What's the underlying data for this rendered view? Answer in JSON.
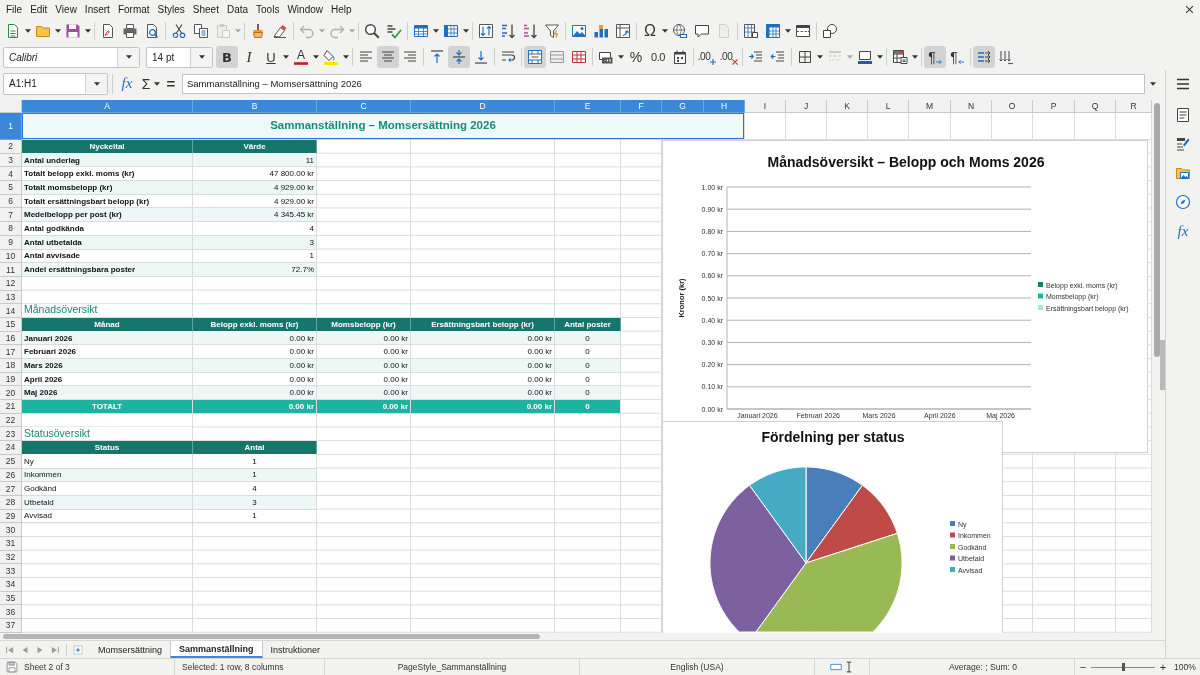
{
  "menu_bar": [
    "File",
    "Edit",
    "View",
    "Insert",
    "Format",
    "Styles",
    "Sheet",
    "Data",
    "Tools",
    "Window",
    "Help"
  ],
  "standard_toolbar": [
    [
      {
        "kind": "new",
        "dropdown": true,
        "disabled": false
      },
      {
        "kind": "open",
        "dropdown": true,
        "disabled": false
      },
      {
        "kind": "save",
        "dropdown": true,
        "disabled": false
      }
    ],
    [
      {
        "kind": "export-pdf",
        "dropdown": false,
        "disabled": false
      },
      {
        "kind": "print",
        "dropdown": false,
        "disabled": false
      },
      {
        "kind": "print-preview",
        "dropdown": false,
        "disabled": false
      }
    ],
    [
      {
        "kind": "cut",
        "dropdown": false,
        "disabled": false
      },
      {
        "kind": "copy",
        "dropdown": false,
        "disabled": false
      },
      {
        "kind": "paste",
        "dropdown": true,
        "disabled": true
      }
    ],
    [
      {
        "kind": "clone-formatting",
        "dropdown": false,
        "disabled": false
      },
      {
        "kind": "clear-formatting",
        "dropdown": false,
        "disabled": false
      }
    ],
    [
      {
        "kind": "undo",
        "dropdown": true,
        "disabled": true
      },
      {
        "kind": "redo",
        "dropdown": true,
        "disabled": true
      }
    ],
    [
      {
        "kind": "find-replace",
        "dropdown": false,
        "disabled": false
      },
      {
        "kind": "spelling",
        "dropdown": false,
        "disabled": false
      }
    ],
    [
      {
        "kind": "rows",
        "dropdown": true,
        "disabled": false
      },
      {
        "kind": "columns",
        "dropdown": true,
        "disabled": false
      }
    ],
    [
      {
        "kind": "sort",
        "dropdown": false,
        "disabled": false
      },
      {
        "kind": "sort-ascending",
        "dropdown": false,
        "disabled": false
      },
      {
        "kind": "sort-descending",
        "dropdown": false,
        "disabled": false
      },
      {
        "kind": "autofilter",
        "dropdown": false,
        "disabled": false
      }
    ],
    [
      {
        "kind": "image",
        "dropdown": false,
        "disabled": false
      },
      {
        "kind": "chart",
        "dropdown": false,
        "disabled": false
      },
      {
        "kind": "pivot-table",
        "dropdown": false,
        "disabled": false
      }
    ],
    [
      {
        "kind": "special-character",
        "glyph": "Ω",
        "dropdown": true,
        "disabled": false
      },
      {
        "kind": "hyperlink",
        "dropdown": false,
        "disabled": false
      },
      {
        "kind": "comment",
        "dropdown": false,
        "disabled": false
      },
      {
        "kind": "header-footer",
        "dropdown": false,
        "disabled": true
      }
    ],
    [
      {
        "kind": "print-area",
        "dropdown": false,
        "disabled": false
      },
      {
        "kind": "freeze",
        "dropdown": true,
        "disabled": false
      },
      {
        "kind": "split-window",
        "dropdown": false,
        "disabled": false
      }
    ],
    [
      {
        "kind": "draw-functions",
        "dropdown": false,
        "disabled": false
      }
    ]
  ],
  "formatting_toolbar": {
    "font_name": "Calibri",
    "font_size": "14 pt",
    "groups": [
      [
        {
          "kind": "bold",
          "glyph": "B",
          "pressed": true,
          "dropdown": false,
          "disabled": false
        },
        {
          "kind": "italic",
          "glyph": "I",
          "pressed": false,
          "dropdown": false,
          "disabled": false
        },
        {
          "kind": "underline",
          "glyph": "U",
          "pressed": false,
          "dropdown": true,
          "disabled": false
        },
        {
          "kind": "font-color",
          "glyph": "A",
          "pressed": false,
          "dropdown": true,
          "disabled": false
        },
        {
          "kind": "highlight",
          "pressed": false,
          "dropdown": true,
          "disabled": false
        }
      ],
      [
        {
          "kind": "align-left",
          "pressed": false,
          "dropdown": false,
          "disabled": false
        },
        {
          "kind": "align-center",
          "pressed": true,
          "dropdown": false,
          "disabled": false
        },
        {
          "kind": "align-right",
          "pressed": false,
          "dropdown": false,
          "disabled": false
        }
      ],
      [
        {
          "kind": "align-top",
          "pressed": false,
          "dropdown": false,
          "disabled": false
        },
        {
          "kind": "align-middle",
          "pressed": true,
          "dropdown": false,
          "disabled": false
        },
        {
          "kind": "align-bottom",
          "pressed": false,
          "dropdown": false,
          "disabled": false
        }
      ],
      [
        {
          "kind": "wrap-text",
          "pressed": false,
          "dropdown": false,
          "disabled": false
        }
      ],
      [
        {
          "kind": "merge-center",
          "pressed": true,
          "dropdown": false,
          "disabled": false
        },
        {
          "kind": "merge",
          "pressed": false,
          "dropdown": false,
          "disabled": false
        },
        {
          "kind": "unmerge",
          "pressed": false,
          "dropdown": false,
          "disabled": false
        }
      ],
      [
        {
          "kind": "currency",
          "pressed": false,
          "dropdown": true,
          "disabled": false
        },
        {
          "kind": "percent",
          "glyph": "%",
          "pressed": false,
          "dropdown": false,
          "disabled": false
        },
        {
          "kind": "number",
          "glyph": "0.0",
          "pressed": false,
          "dropdown": false,
          "disabled": false
        },
        {
          "kind": "date",
          "pressed": false,
          "dropdown": false,
          "disabled": false
        }
      ],
      [
        {
          "kind": "add-decimal",
          "glyph": ".00",
          "pressed": false,
          "dropdown": false,
          "disabled": false
        },
        {
          "kind": "delete-decimal",
          "glyph": ".00",
          "pressed": false,
          "dropdown": false,
          "disabled": false
        }
      ],
      [
        {
          "kind": "increase-indent",
          "pressed": false,
          "dropdown": false,
          "disabled": false
        },
        {
          "kind": "decrease-indent",
          "pressed": false,
          "dropdown": false,
          "disabled": false
        }
      ],
      [
        {
          "kind": "borders",
          "pressed": false,
          "dropdown": true,
          "disabled": false
        },
        {
          "kind": "border-style",
          "pressed": false,
          "dropdown": true,
          "disabled": true
        },
        {
          "kind": "border-color",
          "pressed": false,
          "dropdown": true,
          "disabled": false
        }
      ],
      [
        {
          "kind": "conditional",
          "pressed": false,
          "dropdown": true,
          "disabled": false
        }
      ],
      [
        {
          "kind": "left-to-right",
          "glyph": "¶",
          "pressed": true,
          "dropdown": false,
          "disabled": false
        },
        {
          "kind": "right-to-left",
          "glyph": "¶",
          "pressed": false,
          "dropdown": false,
          "disabled": false
        }
      ],
      [
        {
          "kind": "text-left-to-right",
          "pressed": true,
          "dropdown": false,
          "disabled": false
        },
        {
          "kind": "text-top-to-bottom",
          "pressed": false,
          "dropdown": false,
          "disabled": false
        }
      ]
    ]
  },
  "formula_bar": {
    "name_box": "A1:H1",
    "function_wizard": "fx",
    "sum": "Σ",
    "equals": "=",
    "content": "Sammanställning – Momsersättning 2026"
  },
  "sidebar": {
    "buttons": [
      {
        "kind": "menu"
      },
      {
        "kind": "properties"
      },
      {
        "kind": "styles"
      },
      {
        "kind": "gallery"
      },
      {
        "kind": "navigator"
      },
      {
        "kind": "functions",
        "glyph": "fx"
      }
    ]
  },
  "sheet": {
    "columns": [
      {
        "label": "A",
        "selected": true
      },
      {
        "label": "B",
        "selected": true
      },
      {
        "label": "C",
        "selected": true
      },
      {
        "label": "D",
        "selected": true
      },
      {
        "label": "E",
        "selected": true
      },
      {
        "label": "F",
        "selected": true
      },
      {
        "label": "G",
        "selected": true
      },
      {
        "label": "H",
        "selected": true
      },
      {
        "label": "I",
        "selected": false
      },
      {
        "label": "J",
        "selected": false
      },
      {
        "label": "K",
        "selected": false
      },
      {
        "label": "L",
        "selected": false
      },
      {
        "label": "M",
        "selected": false
      },
      {
        "label": "N",
        "selected": false
      },
      {
        "label": "O",
        "selected": false
      },
      {
        "label": "P",
        "selected": false
      },
      {
        "label": "Q",
        "selected": false
      },
      {
        "label": "R",
        "selected": false
      }
    ],
    "rows": [
      {
        "label": "1",
        "selected": true
      },
      {
        "label": "2",
        "selected": false
      },
      {
        "label": "3",
        "selected": false
      },
      {
        "label": "4",
        "selected": false
      },
      {
        "label": "5",
        "selected": false
      },
      {
        "label": "6",
        "selected": false
      },
      {
        "label": "7",
        "selected": false
      },
      {
        "label": "8",
        "selected": false
      },
      {
        "label": "9",
        "selected": false
      },
      {
        "label": "10",
        "selected": false
      },
      {
        "label": "11",
        "selected": false
      },
      {
        "label": "12",
        "selected": false
      },
      {
        "label": "13",
        "selected": false
      },
      {
        "label": "14",
        "selected": false
      },
      {
        "label": "15",
        "selected": false
      },
      {
        "label": "16",
        "selected": false
      },
      {
        "label": "17",
        "selected": false
      },
      {
        "label": "18",
        "selected": false
      },
      {
        "label": "19",
        "selected": false
      },
      {
        "label": "20",
        "selected": false
      },
      {
        "label": "21",
        "selected": false
      },
      {
        "label": "22",
        "selected": false
      },
      {
        "label": "23",
        "selected": false
      },
      {
        "label": "24",
        "selected": false
      },
      {
        "label": "25",
        "selected": false
      },
      {
        "label": "26",
        "selected": false
      },
      {
        "label": "27",
        "selected": false
      },
      {
        "label": "28",
        "selected": false
      },
      {
        "label": "29",
        "selected": false
      },
      {
        "label": "30",
        "selected": false
      },
      {
        "label": "31",
        "selected": false
      },
      {
        "label": "32",
        "selected": false
      },
      {
        "label": "33",
        "selected": false
      },
      {
        "label": "34",
        "selected": false
      },
      {
        "label": "35",
        "selected": false
      },
      {
        "label": "36",
        "selected": false
      },
      {
        "label": "37",
        "selected": false
      }
    ],
    "title": {
      "text": "Sammanställning – Momsersättning 2026",
      "selected": true
    },
    "key_figures": {
      "columns": [
        "Nyckeltal",
        "Värde"
      ],
      "rows": [
        [
          "Antal underlag",
          "11"
        ],
        [
          "Totalt belopp exkl. moms (kr)",
          "47 800.00 kr"
        ],
        [
          "Totalt momsbelopp (kr)",
          "4 929.00 kr"
        ],
        [
          "Totalt ersättningsbart belopp (kr)",
          "4 929.00 kr"
        ],
        [
          "Medelbelopp per post (kr)",
          "4 345.45 kr"
        ],
        [
          "Antal godkända",
          "4"
        ],
        [
          "Antal utbetalda",
          "3"
        ],
        [
          "Antal avvisade",
          "1"
        ],
        [
          "Andel ersättningsbara poster",
          "72.7%"
        ]
      ]
    },
    "monthly_overview": {
      "heading": "Månadsöversikt",
      "columns": [
        "Månad",
        "Belopp exkl. moms (kr)",
        "Momsbelopp (kr)",
        "Ersättningsbart belopp (kr)",
        "Antal poster"
      ],
      "rows": [
        {
          "kind": "month",
          "cells": [
            "Januari 2026",
            "0.00 kr",
            "0.00 kr",
            "0.00 kr",
            "0"
          ]
        },
        {
          "kind": "month",
          "cells": [
            "Februari 2026",
            "0.00 kr",
            "0.00 kr",
            "0.00 kr",
            "0"
          ]
        },
        {
          "kind": "month",
          "cells": [
            "Mars 2026",
            "0.00 kr",
            "0.00 kr",
            "0.00 kr",
            "0"
          ]
        },
        {
          "kind": "month",
          "cells": [
            "April 2026",
            "0.00 kr",
            "0.00 kr",
            "0.00 kr",
            "0"
          ]
        },
        {
          "kind": "month",
          "cells": [
            "Maj 2026",
            "0.00 kr",
            "0.00 kr",
            "0.00 kr",
            "0"
          ]
        },
        {
          "kind": "total",
          "cells": [
            "TOTALT",
            "0.00 kr",
            "0.00 kr",
            "0.00 kr",
            "0"
          ]
        }
      ]
    },
    "status_overview": {
      "heading": "Statusöversikt",
      "columns": [
        "Status",
        "Antal"
      ],
      "rows": [
        [
          "Ny",
          "1"
        ],
        [
          "Inkommen",
          "1"
        ],
        [
          "Godkänd",
          "4"
        ],
        [
          "Utbetald",
          "3"
        ],
        [
          "Avvisad",
          "1"
        ]
      ]
    },
    "monthly_chart": {
      "chart_data": {
        "type": "bar",
        "title": "Månadsöversikt – Belopp och Moms 2026",
        "ylabel": "Kronor (kr)",
        "categories": [
          "Januari 2026",
          "Februari 2026",
          "Mars 2026",
          "April 2026",
          "Maj 2026"
        ],
        "series": [
          {
            "name": "Belopp exkl. moms (kr)",
            "color": "#1b7b6f",
            "values": [
              0,
              0,
              0,
              0,
              0
            ]
          },
          {
            "name": "Momsbelopp (kr)",
            "color": "#1fb3a0",
            "values": [
              0,
              0,
              0,
              0,
              0
            ]
          },
          {
            "name": "Ersättningsbart belopp (kr)",
            "color": "#a6e8d8",
            "values": [
              0,
              0,
              0,
              0,
              0
            ]
          }
        ],
        "ylim": [
          0,
          1
        ],
        "yticks": [
          {
            "value": 1,
            "label": "1.00 kr"
          },
          {
            "value": 0.9,
            "label": "0.90 kr"
          },
          {
            "value": 0.8,
            "label": "0.80 kr"
          },
          {
            "value": 0.7,
            "label": "0.70 kr"
          },
          {
            "value": 0.6,
            "label": "0.60 kr"
          },
          {
            "value": 0.5,
            "label": "0.50 kr"
          },
          {
            "value": 0.4,
            "label": "0.40 kr"
          },
          {
            "value": 0.3,
            "label": "0.30 kr"
          },
          {
            "value": 0.2,
            "label": "0.20 kr"
          },
          {
            "value": 0.1,
            "label": "0.10 kr"
          },
          {
            "value": 0,
            "label": "0.00 kr"
          }
        ],
        "grid": true,
        "legend": true
      }
    },
    "status_chart": {
      "chart_data": {
        "type": "pie",
        "title": "Fördelning per status",
        "categories": [
          "Ny",
          "Inkommen",
          "Godkänd",
          "Utbetald",
          "Avvisad"
        ],
        "series": [
          {
            "values": [
              10,
              10,
              40,
              30,
              10
            ]
          }
        ],
        "legend": true
      }
    }
  },
  "sheet_tabs": [
    {
      "label": "Momsersättning",
      "selected": false
    },
    {
      "label": "Sammanställning",
      "selected": true
    },
    {
      "label": "Instruktioner",
      "selected": false
    }
  ],
  "status_bar": {
    "sheet_position": "Sheet 2 of 3",
    "selection": "Selected: 1 row, 8 columns",
    "page_style": "PageStyle_Sammanställning",
    "language": "English (USA)",
    "statistics": "Average: ; Sum: 0",
    "zoom": {
      "zoom_out": "−",
      "zoom_in": "+",
      "level": 0.5,
      "reading": "100%"
    }
  }
}
